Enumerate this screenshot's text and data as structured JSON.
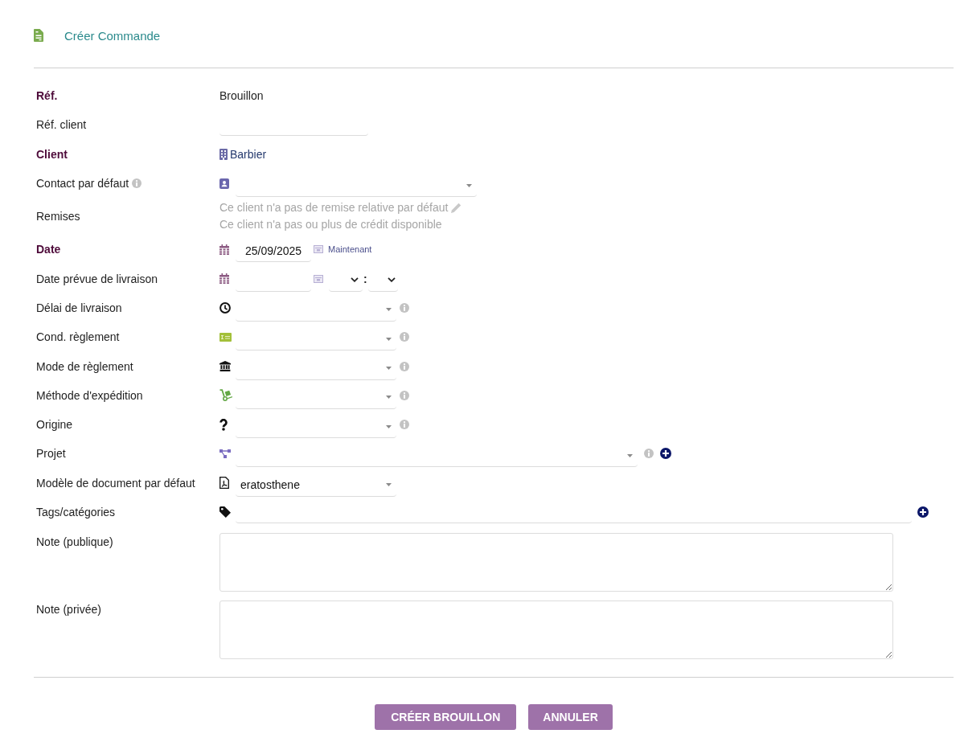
{
  "header": {
    "title": "Créer Commande"
  },
  "form": {
    "rows": [
      {
        "kind": "text",
        "label": "Réf.",
        "required": true,
        "value": "Brouillon"
      },
      {
        "kind": "input",
        "label": "Réf. client",
        "required": false
      },
      {
        "kind": "link",
        "label": "Client",
        "required": true,
        "value": "Barbier"
      },
      {
        "kind": "contact",
        "label": "Contact par défaut",
        "required": false,
        "info": true
      },
      {
        "kind": "remarks",
        "label": "Remises",
        "required": false,
        "lines": [
          {
            "text": "Ce client n'a pas de remise relative par défaut",
            "editable": true
          },
          {
            "text": "Ce client n'a pas ou plus de crédit disponible",
            "editable": false
          }
        ]
      },
      {
        "kind": "date",
        "label": "Date",
        "required": true,
        "value": "25/09/2025",
        "now_link": "Maintenant"
      },
      {
        "kind": "datetime",
        "label": "Date prévue de livraison",
        "required": false,
        "separator": ":"
      },
      {
        "kind": "select",
        "label": "Délai de livraison",
        "required": false,
        "info": true
      },
      {
        "kind": "select",
        "label": "Cond. règlement",
        "required": false,
        "info": true
      },
      {
        "kind": "select",
        "label": "Mode de règlement",
        "required": false,
        "info": true
      },
      {
        "kind": "select",
        "label": "Méthode d'expédition",
        "required": false,
        "info": true
      },
      {
        "kind": "select",
        "label": "Origine",
        "required": false,
        "info": true
      },
      {
        "kind": "project",
        "label": "Projet",
        "required": false,
        "info": true,
        "add": true
      },
      {
        "kind": "select",
        "label": "Modèle de document par défaut",
        "required": false,
        "value": "eratosthene"
      },
      {
        "kind": "tags",
        "label": "Tags/catégories",
        "required": false,
        "add": true
      },
      {
        "kind": "textarea",
        "label": "Note (publique)",
        "required": false
      },
      {
        "kind": "textarea",
        "label": "Note (privée)",
        "required": false
      }
    ]
  },
  "buttons": [
    "CRÉER BROUILLON",
    "ANNULER"
  ]
}
